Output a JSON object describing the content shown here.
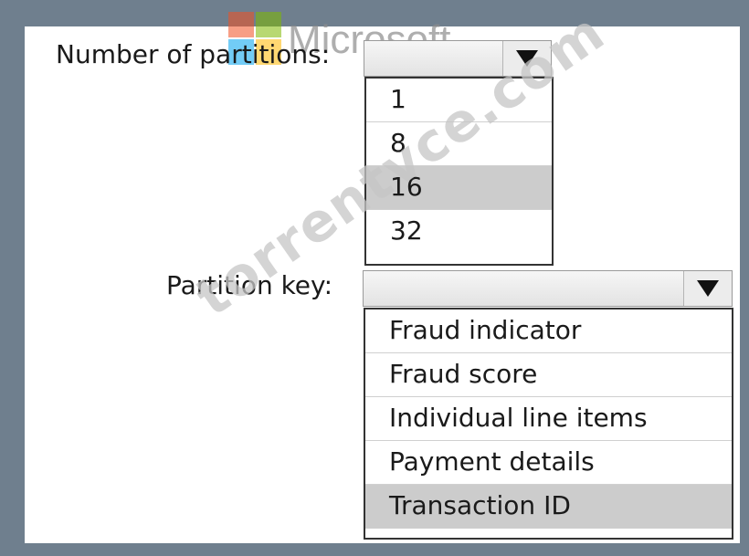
{
  "branding": {
    "logo_text": "Microsoft",
    "logo_colors": [
      "#f25022",
      "#7fba00",
      "#00a4ef",
      "#ffb900"
    ],
    "watermark": "torrentvce.com"
  },
  "partitions": {
    "label": "Number of partitions:",
    "selected_value": "",
    "options": [
      {
        "label": "1",
        "selected": false
      },
      {
        "label": "8",
        "selected": false
      },
      {
        "label": "16",
        "selected": true
      },
      {
        "label": "32",
        "selected": false
      }
    ]
  },
  "partition_key": {
    "label": "Partition key:",
    "selected_value": "",
    "options": [
      {
        "label": "Fraud indicator",
        "selected": false
      },
      {
        "label": "Fraud score",
        "selected": false
      },
      {
        "label": "Individual line items",
        "selected": false
      },
      {
        "label": "Payment details",
        "selected": false
      },
      {
        "label": "Transaction ID",
        "selected": true
      }
    ]
  },
  "colors": {
    "frame": "#6f7f8e",
    "selected_option": "#cccccc"
  },
  "icons": {
    "dropdown": "triangle-down-icon"
  }
}
